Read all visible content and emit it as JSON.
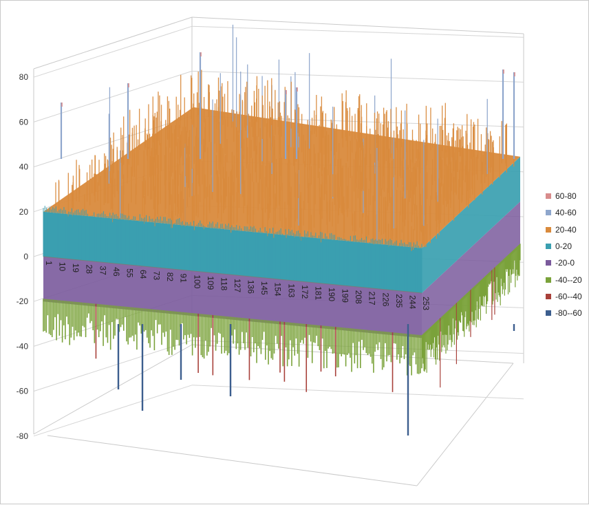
{
  "chart_data": {
    "type": "surface",
    "title": "",
    "zlim": [
      -80,
      80
    ],
    "z_ticks": [
      80,
      60,
      40,
      20,
      0,
      -20,
      -40,
      -60,
      -80
    ],
    "x_ticks": [
      "1",
      "10",
      "19",
      "28",
      "37",
      "46",
      "55",
      "64",
      "73",
      "82",
      "91",
      "100",
      "109",
      "118",
      "127",
      "136",
      "145",
      "154",
      "163",
      "172",
      "181",
      "190",
      "199",
      "208",
      "217",
      "226",
      "235",
      "244",
      "253"
    ],
    "legend_position": "right",
    "bands": [
      {
        "name": "60-80",
        "color": "#d88c8c"
      },
      {
        "name": "40-60",
        "color": "#8ea6cc"
      },
      {
        "name": "20-40",
        "color": "#d98a3c"
      },
      {
        "name": "0-20",
        "color": "#3a9fb0"
      },
      {
        "name": "-20-0",
        "color": "#7a5a9c"
      },
      {
        "name": "-40--20",
        "color": "#7aa23a"
      },
      {
        "name": "-60--40",
        "color": "#a8403a"
      },
      {
        "name": "-80--60",
        "color": "#3c5e8e"
      }
    ],
    "surface_summary": {
      "positive_plateau": 20,
      "positive_spike_max": 80,
      "negative_plateau": -20,
      "negative_spike_min": -68
    }
  }
}
